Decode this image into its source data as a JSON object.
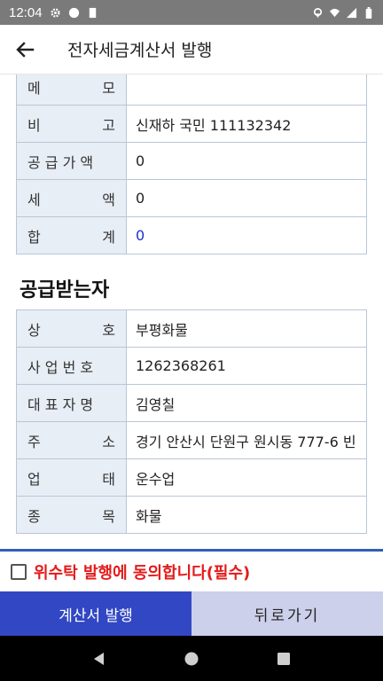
{
  "status_bar": {
    "time": "12:04",
    "left_icons": [
      "gear-icon",
      "circle-icon",
      "sd-card-icon"
    ],
    "right_icons": [
      "location-icon",
      "wifi-icon",
      "signal-icon",
      "battery-icon"
    ]
  },
  "appbar": {
    "back_icon": "arrow-left-icon",
    "title": "전자세금계산서 발행"
  },
  "supplier_table": [
    {
      "k1": "메",
      "k2": "모",
      "value": ""
    },
    {
      "k1": "비",
      "k2": "고",
      "value": "신재하 국민 111132342"
    },
    {
      "k1": "공 급 가 액",
      "k2": "",
      "value": "0"
    },
    {
      "k1": "세",
      "k2": "액",
      "value": "0"
    },
    {
      "k1": "합",
      "k2": "계",
      "value": "0"
    }
  ],
  "receiver_section": {
    "title": "공급받는자",
    "rows": [
      {
        "k1": "상",
        "k2": "호",
        "value": "부평화물"
      },
      {
        "k1": "사 업 번 호",
        "k2": "",
        "value": "1262368261"
      },
      {
        "k1": "대 표 자 명",
        "k2": "",
        "value": "김영칠"
      },
      {
        "k1": "주",
        "k2": "소",
        "value": "경기 안산시 단원구 원시동 777-6  빈"
      },
      {
        "k1": "업",
        "k2": "태",
        "value": "운수업"
      },
      {
        "k1": "종",
        "k2": "목",
        "value": "화물"
      }
    ]
  },
  "agreement": {
    "label": "위수탁 발행에 동의합니다(필수)",
    "checked": false
  },
  "buttons": {
    "issue_label": "계산서 발행",
    "back_label": "뒤로가기"
  },
  "colors": {
    "primary": "#3147c4",
    "secondary_button": "#cdd0ea",
    "required_text": "#e41a1a",
    "total_value": "#1a33cc",
    "label_cell": "#e8eef5"
  }
}
